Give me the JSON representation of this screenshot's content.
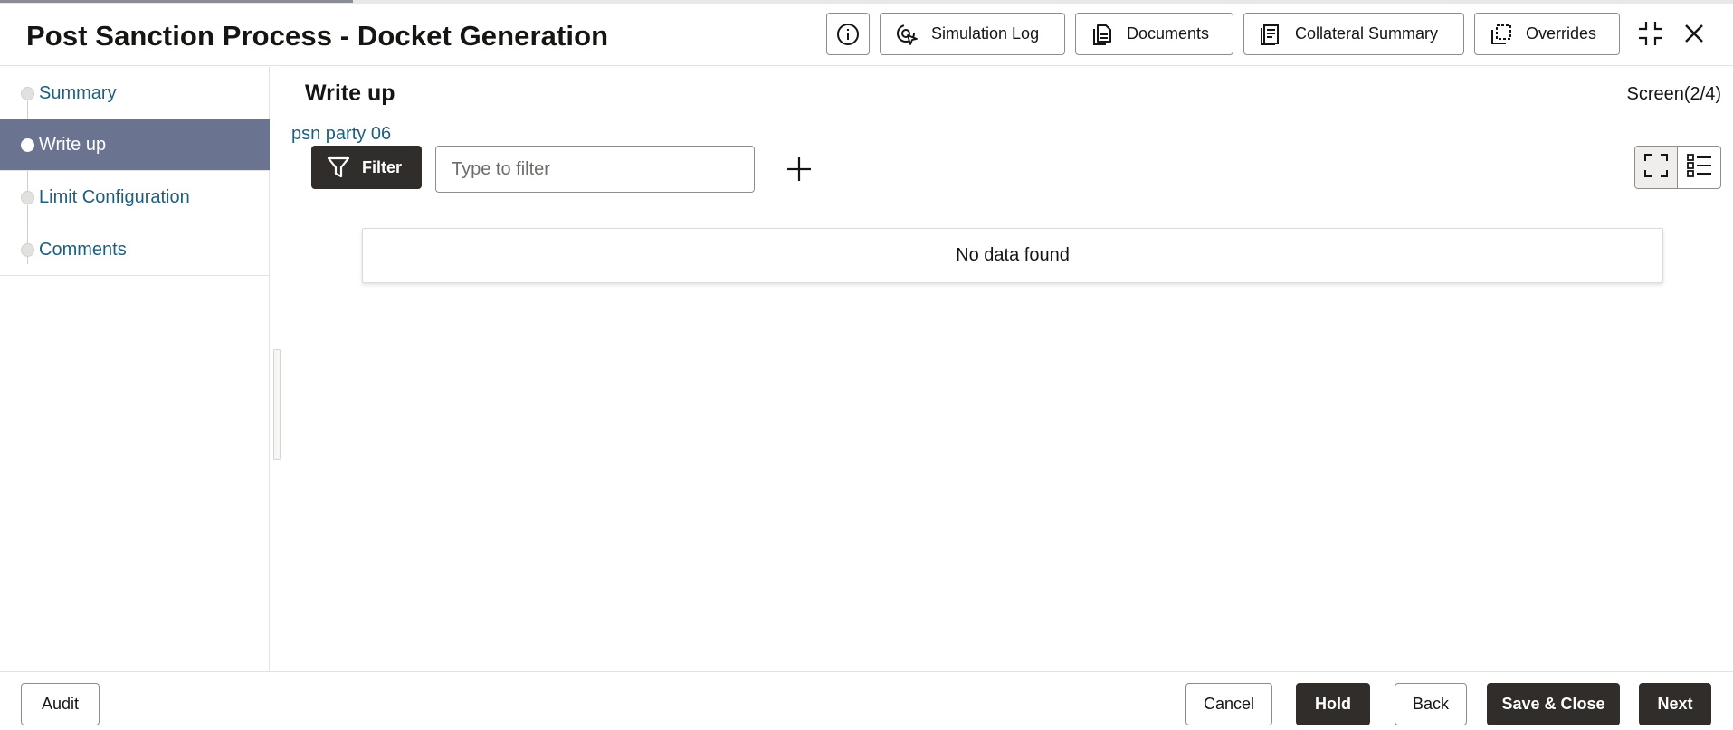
{
  "header": {
    "title": "Post Sanction Process - Docket Generation",
    "buttons": {
      "simulation_log": "Simulation Log",
      "documents": "Documents",
      "collateral_summary": "Collateral Summary",
      "overrides": "Overrides"
    },
    "icons": [
      "info-icon",
      "simulation-log-icon",
      "documents-icon",
      "collateral-summary-icon",
      "overrides-icon",
      "minimize-icon",
      "close-icon"
    ]
  },
  "sidebar": {
    "items": [
      {
        "label": "Summary",
        "active": false
      },
      {
        "label": "Write up",
        "active": true
      },
      {
        "label": "Limit Configuration",
        "active": false
      },
      {
        "label": "Comments",
        "active": false
      }
    ]
  },
  "main": {
    "title": "Write up",
    "screen_count": "Screen(2/4)",
    "party_name": "psn party 06",
    "filter_label": "Filter",
    "filter_placeholder": "Type to filter",
    "empty_message": "No data found"
  },
  "footer": {
    "audit": "Audit",
    "cancel": "Cancel",
    "hold": "Hold",
    "back": "Back",
    "save_close": "Save & Close",
    "next": "Next"
  },
  "colors": {
    "accent_dark": "#312d2a",
    "active_nav": "#6a7491",
    "link": "#1f5f7d"
  }
}
